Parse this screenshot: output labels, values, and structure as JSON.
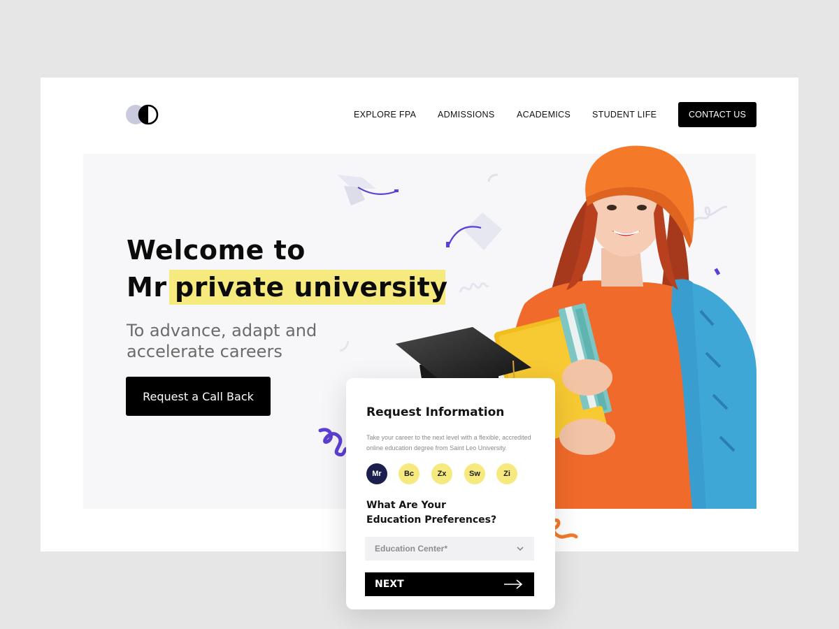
{
  "header": {
    "nav": [
      "EXPLORE FPA",
      "ADMISSIONS",
      "ACADEMICS",
      "STUDENT LIFE"
    ],
    "contact_label": "CONTACT US"
  },
  "hero": {
    "title_line1": "Welcome to",
    "title_line2_plain": "Mr",
    "title_line2_highlight": "private university",
    "subtitle_line1": "To advance, adapt and",
    "subtitle_line2": "accelerate careers",
    "cta_label": "Request a Call Back"
  },
  "card": {
    "title": "Request Information",
    "description": "Take your career to the next level with a flexible, accredited online education degree from Saint Leo University.",
    "chips": [
      "Mr",
      "Bc",
      "Zx",
      "Sw",
      "Zi"
    ],
    "question_line1": "What Are Your",
    "question_line2": "Education Preferences?",
    "select_placeholder": "Education Center*",
    "next_label": "NEXT"
  },
  "colors": {
    "accent_yellow": "#f6e97d",
    "accent_navy": "#1b1f4e",
    "accent_purple": "#5b3fd6",
    "accent_orange": "#f47a2a"
  }
}
